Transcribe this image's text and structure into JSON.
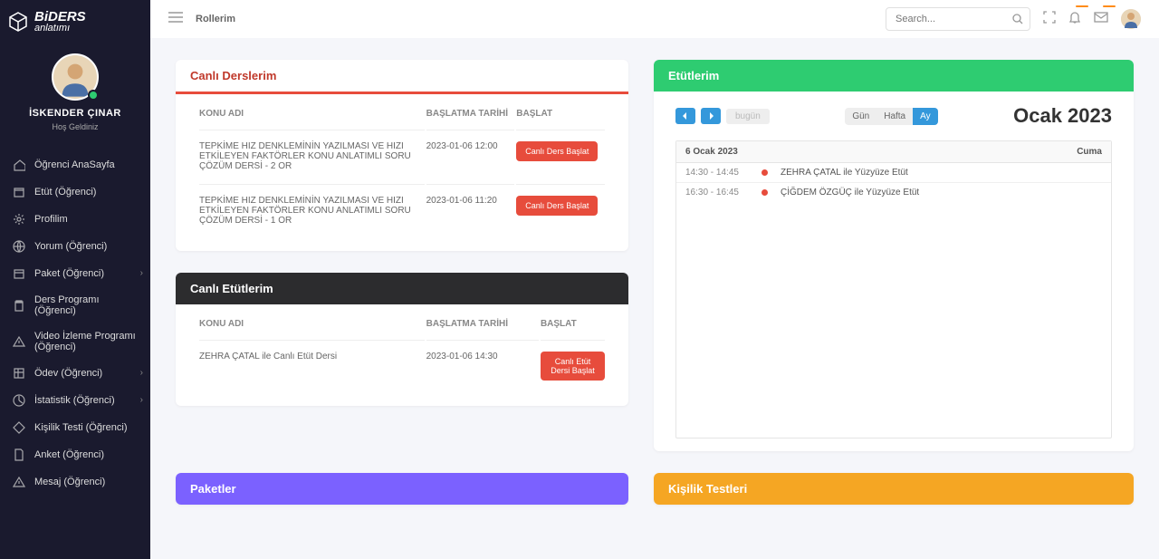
{
  "logo": {
    "brand": "BiDERS",
    "sub": "anlatımı"
  },
  "user": {
    "name": "İSKENDER ÇINAR",
    "welcome": "Hoş Geldiniz"
  },
  "sidebar": {
    "items": [
      {
        "label": "Öğrenci AnaSayfa",
        "icon": "home",
        "chev": false
      },
      {
        "label": "Etüt (Öğrenci)",
        "icon": "calendar",
        "chev": false
      },
      {
        "label": "Profilim",
        "icon": "gear",
        "chev": false
      },
      {
        "label": "Yorum (Öğrenci)",
        "icon": "globe",
        "chev": false
      },
      {
        "label": "Paket (Öğrenci)",
        "icon": "box",
        "chev": true
      },
      {
        "label": "Ders Programı (Öğrenci)",
        "icon": "clipboard",
        "chev": false
      },
      {
        "label": "Video İzleme Programı (Öğrenci)",
        "icon": "warn",
        "chev": false
      },
      {
        "label": "Ödev (Öğrenci)",
        "icon": "table",
        "chev": true
      },
      {
        "label": "İstatistik (Öğrenci)",
        "icon": "chart",
        "chev": true
      },
      {
        "label": "Kişilik Testi (Öğrenci)",
        "icon": "diamond",
        "chev": false
      },
      {
        "label": "Anket (Öğrenci)",
        "icon": "doc",
        "chev": false
      },
      {
        "label": "Mesaj (Öğrenci)",
        "icon": "warn",
        "chev": false
      }
    ]
  },
  "topbar": {
    "breadcrumb": "Rollerim",
    "search_placeholder": "Search...",
    "badge_notif": "",
    "badge_mail": ""
  },
  "cards": {
    "live_lessons": {
      "title": "Canlı Derslerim",
      "cols": {
        "topic": "KONU ADI",
        "date": "BAŞLATMA TARİHİ",
        "action": "BAŞLAT"
      },
      "rows": [
        {
          "topic": "TEPKİME HIZ DENKLEMİNİN YAZILMASI VE HIZI ETKİLEYEN FAKTÖRLER KONU ANLATIMLI SORU ÇÖZÜM DERSİ - 2 OR",
          "date": "2023-01-06 12:00",
          "btn": "Canlı Ders Başlat"
        },
        {
          "topic": "TEPKİME HIZ DENKLEMİNİN YAZILMASI VE HIZI ETKİLEYEN FAKTÖRLER KONU ANLATIMLI SORU ÇÖZÜM DERSİ - 1 OR",
          "date": "2023-01-06 11:20",
          "btn": "Canlı Ders Başlat"
        }
      ]
    },
    "live_etut": {
      "title": "Canlı Etütlerim",
      "cols": {
        "topic": "KONU ADI",
        "date": "BAŞLATMA TARİHİ",
        "action": "BAŞLAT"
      },
      "rows": [
        {
          "topic": "ZEHRA ÇATAL ile Canlı Etüt Dersi",
          "date": "2023-01-06 14:30",
          "btn": "Canlı Etüt Dersi Başlat"
        }
      ]
    },
    "etutlerim": {
      "title": "Etütlerim",
      "today": "bugün",
      "views": {
        "day": "Gün",
        "week": "Hafta",
        "month": "Ay"
      },
      "month_title": "Ocak 2023",
      "dayhead": {
        "date": "6 Ocak 2023",
        "dow": "Cuma"
      },
      "events": [
        {
          "time": "14:30 - 14:45",
          "text": "ZEHRA ÇATAL ile Yüzyüze Etüt"
        },
        {
          "time": "16:30 - 16:45",
          "text": "ÇİĞDEM ÖZGÜÇ ile Yüzyüze Etüt"
        }
      ]
    },
    "paketler": {
      "title": "Paketler"
    },
    "kisilik": {
      "title": "Kişilik Testleri"
    }
  }
}
